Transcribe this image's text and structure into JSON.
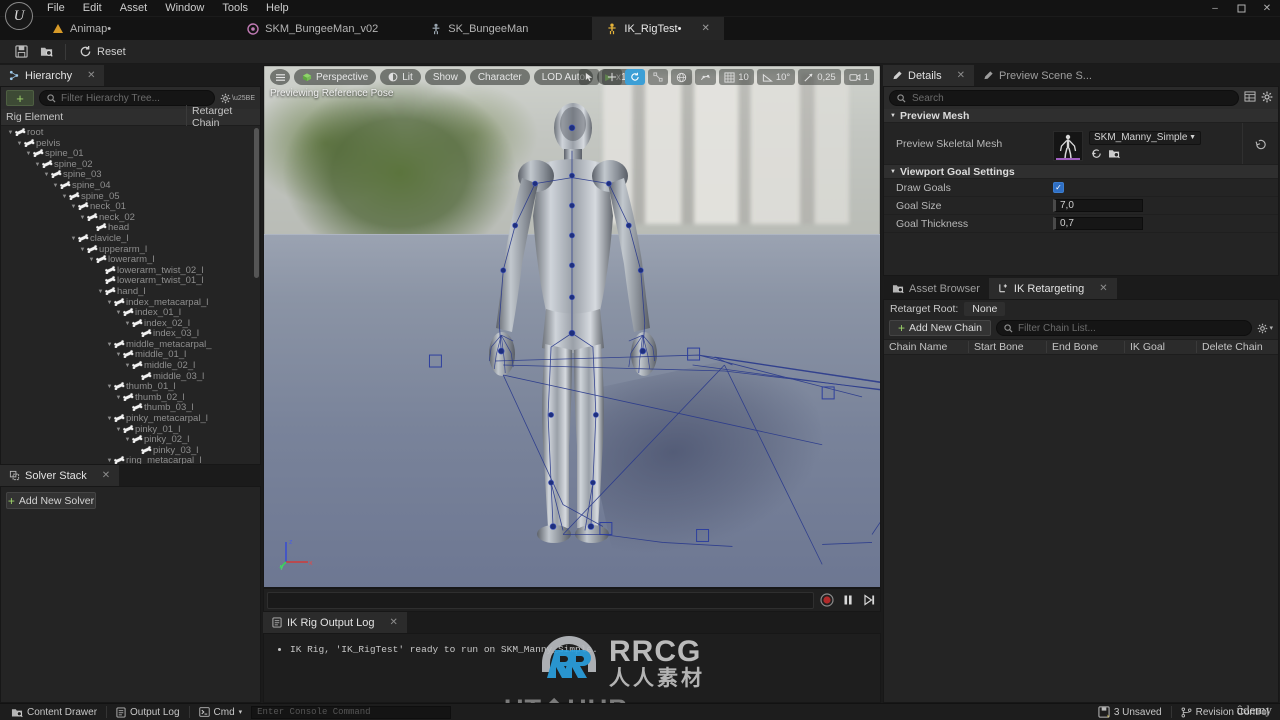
{
  "window": {
    "minimize": "–",
    "maximize": "❐",
    "close": "✕"
  },
  "menubar": {
    "items": [
      "File",
      "Edit",
      "Asset",
      "Window",
      "Tools",
      "Help"
    ]
  },
  "tabs": [
    {
      "label": "Animap•",
      "icon": "animap-icon",
      "active": false
    },
    {
      "label": "SKM_BungeeMan_v02",
      "icon": "skeletal-mesh-icon",
      "active": false
    },
    {
      "label": "SK_BungeeMan",
      "icon": "skeleton-icon",
      "active": false
    },
    {
      "label": "IK_RigTest•",
      "icon": "ik-rig-icon",
      "active": true,
      "close": "✕"
    }
  ],
  "toolbar": {
    "save_label": "Save",
    "browse_label": "Browse",
    "reset_label": "Reset"
  },
  "hierarchy": {
    "tab_label": "Hierarchy",
    "close": "✕",
    "add_label": "+",
    "filter_placeholder": "Filter Hierarchy Tree...",
    "columns": [
      "Rig Element",
      "Retarget Chain"
    ],
    "tree": [
      {
        "label": "root",
        "depth": 0,
        "expanded": true
      },
      {
        "label": "pelvis",
        "depth": 1,
        "expanded": true
      },
      {
        "label": "spine_01",
        "depth": 2,
        "expanded": true
      },
      {
        "label": "spine_02",
        "depth": 3,
        "expanded": true
      },
      {
        "label": "spine_03",
        "depth": 4,
        "expanded": true
      },
      {
        "label": "spine_04",
        "depth": 5,
        "expanded": true
      },
      {
        "label": "spine_05",
        "depth": 6,
        "expanded": true
      },
      {
        "label": "neck_01",
        "depth": 7,
        "expanded": true
      },
      {
        "label": "neck_02",
        "depth": 8,
        "expanded": true
      },
      {
        "label": "head",
        "depth": 9,
        "expanded": false
      },
      {
        "label": "clavicle_l",
        "depth": 7,
        "expanded": true
      },
      {
        "label": "upperarm_l",
        "depth": 8,
        "expanded": true
      },
      {
        "label": "lowerarm_l",
        "depth": 9,
        "expanded": true
      },
      {
        "label": "lowerarm_twist_02_l",
        "depth": 10,
        "expanded": false
      },
      {
        "label": "lowerarm_twist_01_l",
        "depth": 10,
        "expanded": false
      },
      {
        "label": "hand_l",
        "depth": 10,
        "expanded": true
      },
      {
        "label": "index_metacarpal_l",
        "depth": 11,
        "expanded": true
      },
      {
        "label": "index_01_l",
        "depth": 12,
        "expanded": true
      },
      {
        "label": "index_02_l",
        "depth": 13,
        "expanded": true
      },
      {
        "label": "index_03_l",
        "depth": 14,
        "expanded": false
      },
      {
        "label": "middle_metacarpal_",
        "depth": 11,
        "expanded": true
      },
      {
        "label": "middle_01_l",
        "depth": 12,
        "expanded": true
      },
      {
        "label": "middle_02_l",
        "depth": 13,
        "expanded": true
      },
      {
        "label": "middle_03_l",
        "depth": 14,
        "expanded": false
      },
      {
        "label": "thumb_01_l",
        "depth": 11,
        "expanded": true
      },
      {
        "label": "thumb_02_l",
        "depth": 12,
        "expanded": true
      },
      {
        "label": "thumb_03_l",
        "depth": 13,
        "expanded": false
      },
      {
        "label": "pinky_metacarpal_l",
        "depth": 11,
        "expanded": true
      },
      {
        "label": "pinky_01_l",
        "depth": 12,
        "expanded": true
      },
      {
        "label": "pinky_02_l",
        "depth": 13,
        "expanded": true
      },
      {
        "label": "pinky_03_l",
        "depth": 14,
        "expanded": false
      },
      {
        "label": "ring_metacarpal_l",
        "depth": 11,
        "expanded": true
      }
    ]
  },
  "solver": {
    "tab_label": "Solver Stack",
    "close": "✕",
    "add_label": "Add New Solver",
    "add_plus": "+"
  },
  "viewport": {
    "menu_icon": "viewport-menu-icon",
    "perspective": "Perspective",
    "lit": "Lit",
    "show": "Show",
    "character": "Character",
    "lod": "LOD Auto",
    "play_speed": "x1,0",
    "play_icon": "▶",
    "status": "Previewing Reference Pose",
    "gizmos": {
      "select": "select-tool-icon",
      "move": "move-tool-icon",
      "rotate": "rotate-tool-icon",
      "scale": "scale-tool-icon",
      "world": "world-space-icon",
      "surface": "surface-snap-icon",
      "grid_value": "10",
      "angle_value": "10°",
      "scale_value": "0,25",
      "camera_value": "1"
    }
  },
  "timeline": {
    "record": "record-button",
    "pause": "pause-button",
    "step": "step-forward-button"
  },
  "output_log": {
    "tab_label": "IK Rig Output Log",
    "close": "✕",
    "lines": [
      "IK Rig, 'IK_RigTest' ready to run on SKM_Manny_Simple."
    ]
  },
  "details": {
    "tabs": [
      {
        "label": "Details",
        "active": true,
        "close": "✕"
      },
      {
        "label": "Preview Scene S...",
        "active": false
      }
    ],
    "search_placeholder": "Search",
    "sections": [
      {
        "title": "Preview Mesh",
        "rows": [
          {
            "label": "Preview Skeletal Mesh",
            "type": "asset",
            "value": "SKM_Manny_Simple"
          }
        ]
      },
      {
        "title": "Viewport Goal Settings",
        "rows": [
          {
            "label": "Draw Goals",
            "type": "checkbox",
            "value": true
          },
          {
            "label": "Goal Size",
            "type": "number",
            "value": "7,0"
          },
          {
            "label": "Goal Thickness",
            "type": "number",
            "value": "0,7"
          }
        ]
      }
    ]
  },
  "retargeting": {
    "tabs": [
      {
        "label": "Asset Browser",
        "active": false
      },
      {
        "label": "IK Retargeting",
        "active": true,
        "close": "✕"
      }
    ],
    "root_label": "Retarget Root:",
    "root_value": "None",
    "add_chain_label": "Add New Chain",
    "add_chain_plus": "+",
    "filter_placeholder": "Filter Chain List...",
    "columns": [
      "Chain Name",
      "Start Bone",
      "End Bone",
      "IK Goal",
      "Delete Chain"
    ],
    "rows": []
  },
  "statusbar": {
    "content_drawer": "Content Drawer",
    "output_log": "Output Log",
    "cmd": "Cmd",
    "console_placeholder": "Enter Console Command",
    "unsaved": "3 Unsaved",
    "revision": "Revision Control"
  },
  "watermarks": {
    "rrcg": "RRCG",
    "rrcg_cn": "人人素材",
    "uthub": "UT❖HUB",
    "udemy": "ûdemy"
  },
  "colors": {
    "accent_blue": "#3c9fd6",
    "green": "#9fd46a",
    "panel_bg": "#242424",
    "dark_bg": "#1b1b1b",
    "record_red": "#c03030"
  }
}
